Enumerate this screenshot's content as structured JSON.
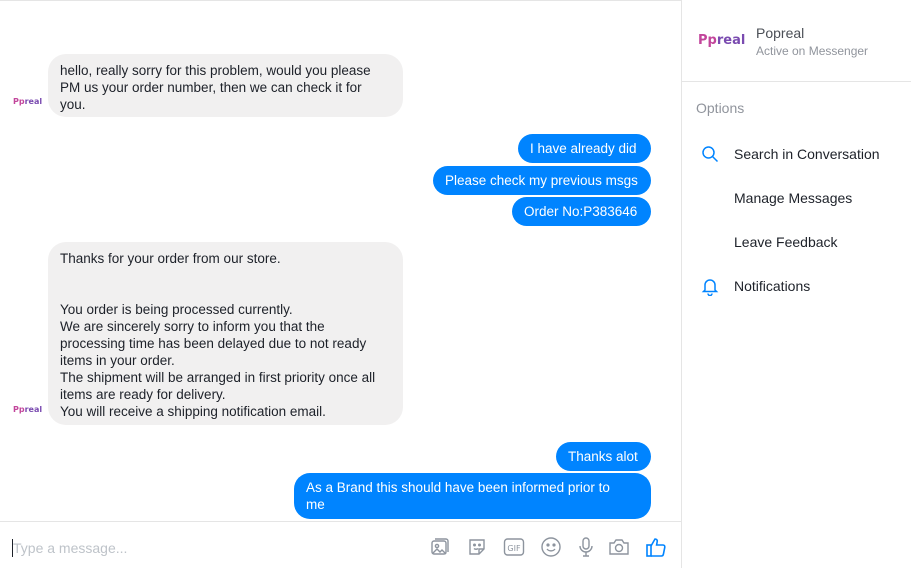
{
  "conversation": {
    "top_truncated_text": "···· ···· ··",
    "messages": [
      {
        "direction": "in",
        "lines": [
          "hello, really sorry for this problem, would you please",
          "PM us your order number, then we can check it for",
          "you."
        ]
      },
      {
        "direction": "out",
        "text": "I have already did"
      },
      {
        "direction": "out",
        "text": "Please check my previous msgs"
      },
      {
        "direction": "out",
        "text": "Order No:P383646"
      },
      {
        "direction": "in",
        "lines": [
          "Thanks for your order from our store.",
          "",
          "",
          "You order is being processed currently.",
          "We are sincerely sorry to inform you that the",
          "processing time has been delayed due to not ready",
          "items in your order.",
          "The shipment will be arranged in first priority once all",
          "items are ready for delivery.",
          "You will receive a shipping notification email."
        ]
      },
      {
        "direction": "out",
        "text": "Thanks alot"
      },
      {
        "direction": "out",
        "lines": [
          "As a Brand this should have been informed prior to",
          "me"
        ]
      }
    ]
  },
  "avatar": {
    "brand_prefix": "Pp",
    "brand_suffix": "real"
  },
  "composer": {
    "placeholder": "Type a message...",
    "tools": [
      "stickers-icon",
      "emoji-sticker-icon",
      "gif-icon",
      "emoji-icon",
      "microphone-icon",
      "camera-icon",
      "thumbs-up-icon"
    ],
    "gif_label": "GIF"
  },
  "info": {
    "page_name": "Popreal",
    "page_status": "Active on Messenger",
    "logo_prefix": "Pp",
    "logo_suffix": "real",
    "options_title": "Options",
    "options": [
      {
        "label": "Search in Conversation",
        "icon": "search-icon"
      },
      {
        "label": "Manage Messages",
        "icon": ""
      },
      {
        "label": "Leave Feedback",
        "icon": ""
      },
      {
        "label": "Notifications",
        "icon": "bell-icon"
      }
    ]
  },
  "colors": {
    "outgoing_bubble": "#0084ff",
    "incoming_bubble": "#f1f0f0",
    "accent": "#0084ff",
    "muted_text": "#90949c"
  }
}
